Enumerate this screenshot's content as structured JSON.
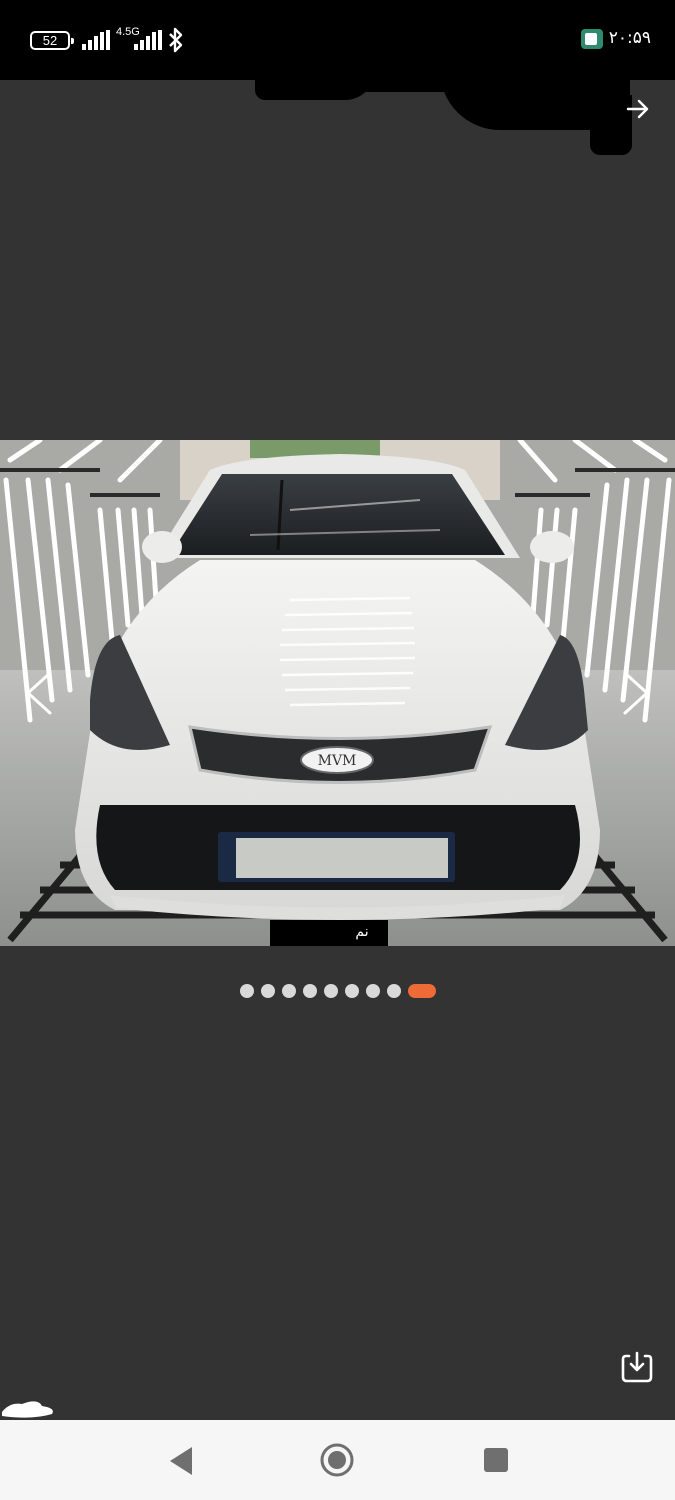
{
  "status_bar": {
    "battery": "52",
    "network": "4.5G",
    "time": "۲۰:۵۹"
  },
  "icons": {
    "bluetooth": "bluetooth-icon",
    "signal": "signal-strength-icon",
    "forward": "arrow-right-icon",
    "prev": "chevron-left-icon",
    "next": "chevron-right-icon",
    "download": "download-icon",
    "back": "back-triangle-icon",
    "home": "home-circle-icon",
    "recent": "recent-square-icon"
  },
  "gallery": {
    "total_images": 9,
    "active_index": 8,
    "caption": "نم"
  },
  "colors": {
    "background": "#333333",
    "accent": "#ee6a36",
    "dot_inactive": "#d9d9d9",
    "navbar": "#f6f6f6"
  }
}
